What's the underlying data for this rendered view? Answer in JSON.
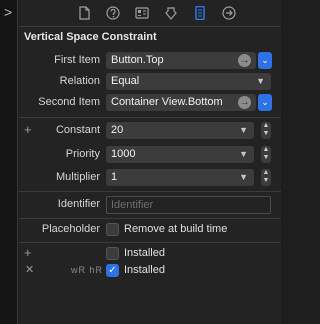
{
  "sidebar_toggle": {
    "icon": "chevron-right-icon",
    "glyph": ">"
  },
  "tabs": [
    {
      "name": "file-icon"
    },
    {
      "name": "help-icon"
    },
    {
      "name": "identity-icon"
    },
    {
      "name": "attributes-icon"
    },
    {
      "name": "size-icon",
      "active": true
    },
    {
      "name": "connections-icon"
    }
  ],
  "section_title": "Vertical Space Constraint",
  "first_item": {
    "label": "First Item",
    "value": "Button.Top"
  },
  "relation": {
    "label": "Relation",
    "value": "Equal"
  },
  "second_item": {
    "label": "Second Item",
    "value": "Container View.Bottom"
  },
  "constant": {
    "label": "Constant",
    "value": "20"
  },
  "priority": {
    "label": "Priority",
    "value": "1000"
  },
  "multiplier": {
    "label": "Multiplier",
    "value": "1"
  },
  "identifier": {
    "label": "Identifier",
    "placeholder": "Identifier"
  },
  "placeholder": {
    "label": "Placeholder",
    "checkbox_label": "Remove at build time",
    "checked": false
  },
  "installed_default": {
    "label": "Installed",
    "checked": false
  },
  "installed_variation": {
    "size_class": "wR hR",
    "label": "Installed",
    "checked": true
  },
  "colors": {
    "accent": "#2e72e6",
    "background": "#232323",
    "field": "#3c3c3c"
  }
}
